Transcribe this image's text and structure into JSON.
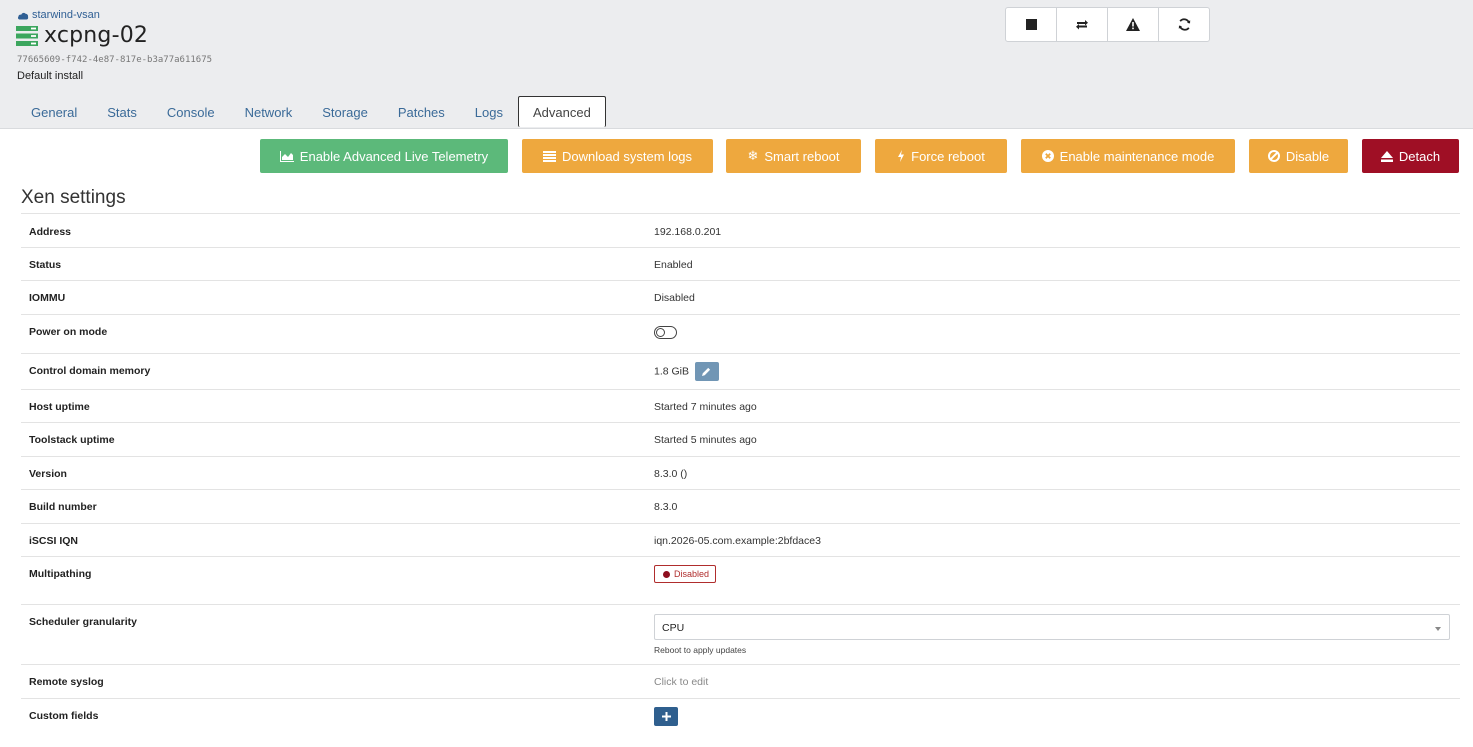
{
  "header": {
    "pool_name": "starwind-vsan",
    "host_name": "xcpng-02",
    "uuid": "77665609-f742-4e87-817e-b3a77a611675",
    "description": "Default install",
    "icon_buttons": [
      "stop-icon",
      "restart-toolstack-icon",
      "warning-icon",
      "refresh-icon"
    ]
  },
  "tabs": [
    {
      "label": "General",
      "active": false
    },
    {
      "label": "Stats",
      "active": false
    },
    {
      "label": "Console",
      "active": false
    },
    {
      "label": "Network",
      "active": false
    },
    {
      "label": "Storage",
      "active": false
    },
    {
      "label": "Patches",
      "active": false
    },
    {
      "label": "Logs",
      "active": false
    },
    {
      "label": "Advanced",
      "active": true
    }
  ],
  "actions": [
    {
      "label": "Enable Advanced Live Telemetry",
      "icon": "area-chart-icon",
      "color": "#5cb97a"
    },
    {
      "label": "Download system logs",
      "icon": "list-icon",
      "color": "#eea83e"
    },
    {
      "label": "Smart reboot",
      "icon": "snowflake-icon",
      "color": "#eea83e"
    },
    {
      "label": "Force reboot",
      "icon": "bolt-icon",
      "color": "#eea83e"
    },
    {
      "label": "Enable maintenance mode",
      "icon": "times-circle-icon",
      "color": "#eea83e"
    },
    {
      "label": "Disable",
      "icon": "ban-icon",
      "color": "#eea83e"
    },
    {
      "label": "Detach",
      "icon": "eject-icon",
      "color": "#9f0f25"
    }
  ],
  "xen_settings": {
    "title": "Xen settings",
    "rows": {
      "address": {
        "label": "Address",
        "value": "192.168.0.201"
      },
      "status": {
        "label": "Status",
        "value": "Enabled"
      },
      "iommu": {
        "label": "IOMMU",
        "value": "Disabled"
      },
      "power_on_mode": {
        "label": "Power on mode",
        "toggle_on": false
      },
      "control_domain_memory": {
        "label": "Control domain memory",
        "value": "1.8 GiB"
      },
      "host_uptime": {
        "label": "Host uptime",
        "value": "Started 7 minutes ago"
      },
      "toolstack_uptime": {
        "label": "Toolstack uptime",
        "value": "Started 5 minutes ago"
      },
      "version": {
        "label": "Version",
        "value": "8.3.0 ()"
      },
      "build_number": {
        "label": "Build number",
        "value": "8.3.0"
      },
      "iscsi_iqn": {
        "label": "iSCSI IQN",
        "value": "iqn.2026-05.com.example:2bfdace3"
      },
      "multipathing": {
        "label": "Multipathing",
        "badge": "Disabled"
      },
      "scheduler_granularity": {
        "label": "Scheduler granularity",
        "selected": "CPU",
        "help": "Reboot to apply updates"
      },
      "remote_syslog": {
        "label": "Remote syslog",
        "value": "Click to edit"
      },
      "custom_fields": {
        "label": "Custom fields"
      }
    }
  }
}
